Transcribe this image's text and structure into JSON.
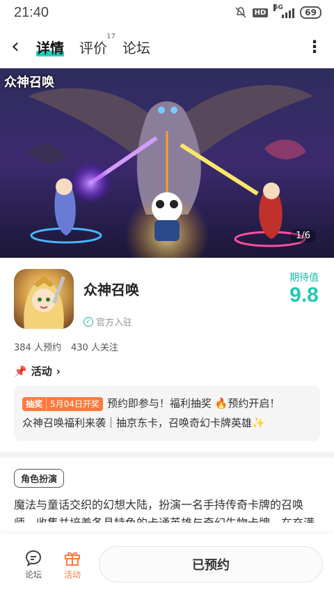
{
  "status_bar": {
    "time": "21:40",
    "hd": "HD",
    "network": "5G",
    "battery": "69"
  },
  "nav": {
    "tabs": [
      {
        "label": "详情",
        "active": true
      },
      {
        "label": "评价",
        "badge": "17"
      },
      {
        "label": "论坛"
      }
    ]
  },
  "banner": {
    "logo_text": "众神召唤",
    "counter": "1/6"
  },
  "game": {
    "name": "众神召唤",
    "verified_label": "官方入驻",
    "expect_label": "期待值",
    "expect_value": "9.8",
    "reservations": "384 人预约",
    "followers": "430 人关注"
  },
  "activity": {
    "header": "活动",
    "tag_type": "抽奖",
    "tag_date": "5月04日开奖",
    "text_line1": "预约即参与！福利抽奖 🔥预约开启！",
    "text_line2": "众神召唤福利来袭｜抽京东卡，召唤奇幻卡牌英雄✨"
  },
  "genre_tag": "角色扮演",
  "description": "魔法与童话交织的幻想大陆，扮演一名手持传奇卡牌的召唤师，收集并培养各具特色的卡通英雄与奇幻生物卡牌，在充满",
  "bottom": {
    "forum_label": "论坛",
    "activity_label": "活动",
    "reserve_button": "已预约"
  },
  "colors": {
    "accent": "#1fc9b8",
    "orange": "#ff7a3c"
  },
  "icons": [
    "back-arrow-icon",
    "more-icon",
    "verified-icon",
    "pin-icon",
    "chevron-right-icon",
    "forum-icon",
    "gift-icon"
  ]
}
